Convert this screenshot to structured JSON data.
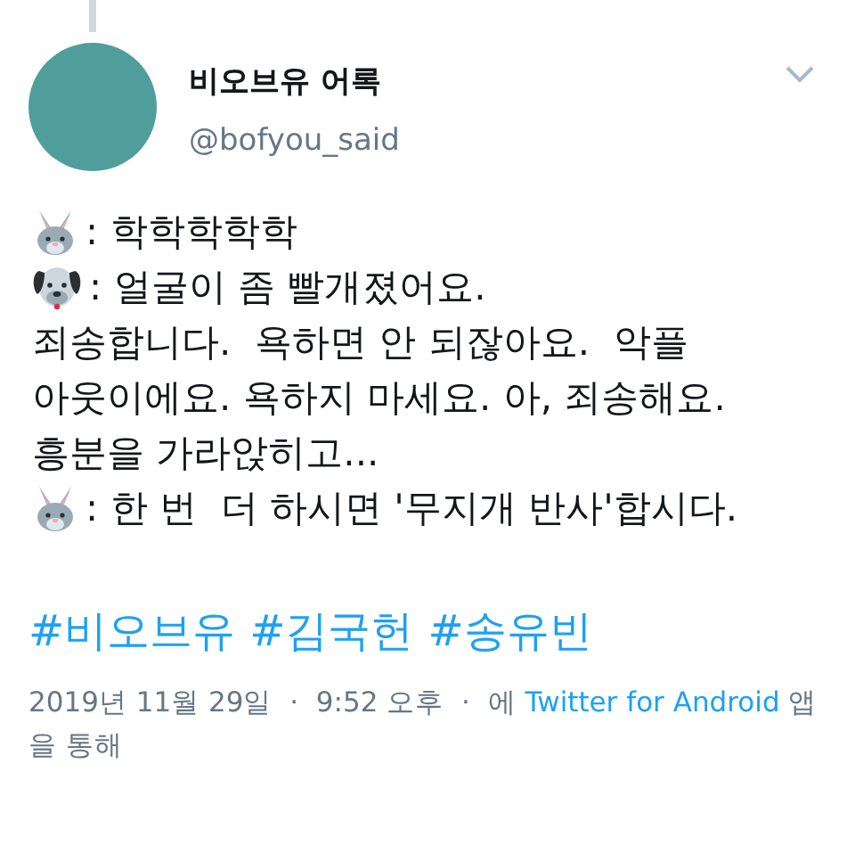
{
  "author": {
    "name": "비오브유 어록",
    "handle": "@bofyou_said"
  },
  "lines": [
    {
      "kind": "rabbit",
      "text": ": 학학학학학"
    },
    {
      "kind": "dog",
      "text": ": 얼굴이 좀 빨개졌어요."
    },
    {
      "kind": "plain",
      "text": "죄송합니다.  욕하면 안 되잖아요.  악플"
    },
    {
      "kind": "plain",
      "text": "아웃이에요. 욕하지 마세요. 아, 죄송해요."
    },
    {
      "kind": "plain",
      "text": "흥분을 가라앉히고..."
    },
    {
      "kind": "rabbit",
      "text": ": 한 번  더 하시면 '무지개 반사'합시다."
    }
  ],
  "hashtags": [
    "#비오브유",
    "#김국헌",
    "#송유빈"
  ],
  "meta": {
    "date": "2019년 11월 29일",
    "separator": "·",
    "time": "9:52 오후",
    "via_prefix": "에",
    "source": "Twitter for Android",
    "via_suffix": "앱을 통해"
  }
}
